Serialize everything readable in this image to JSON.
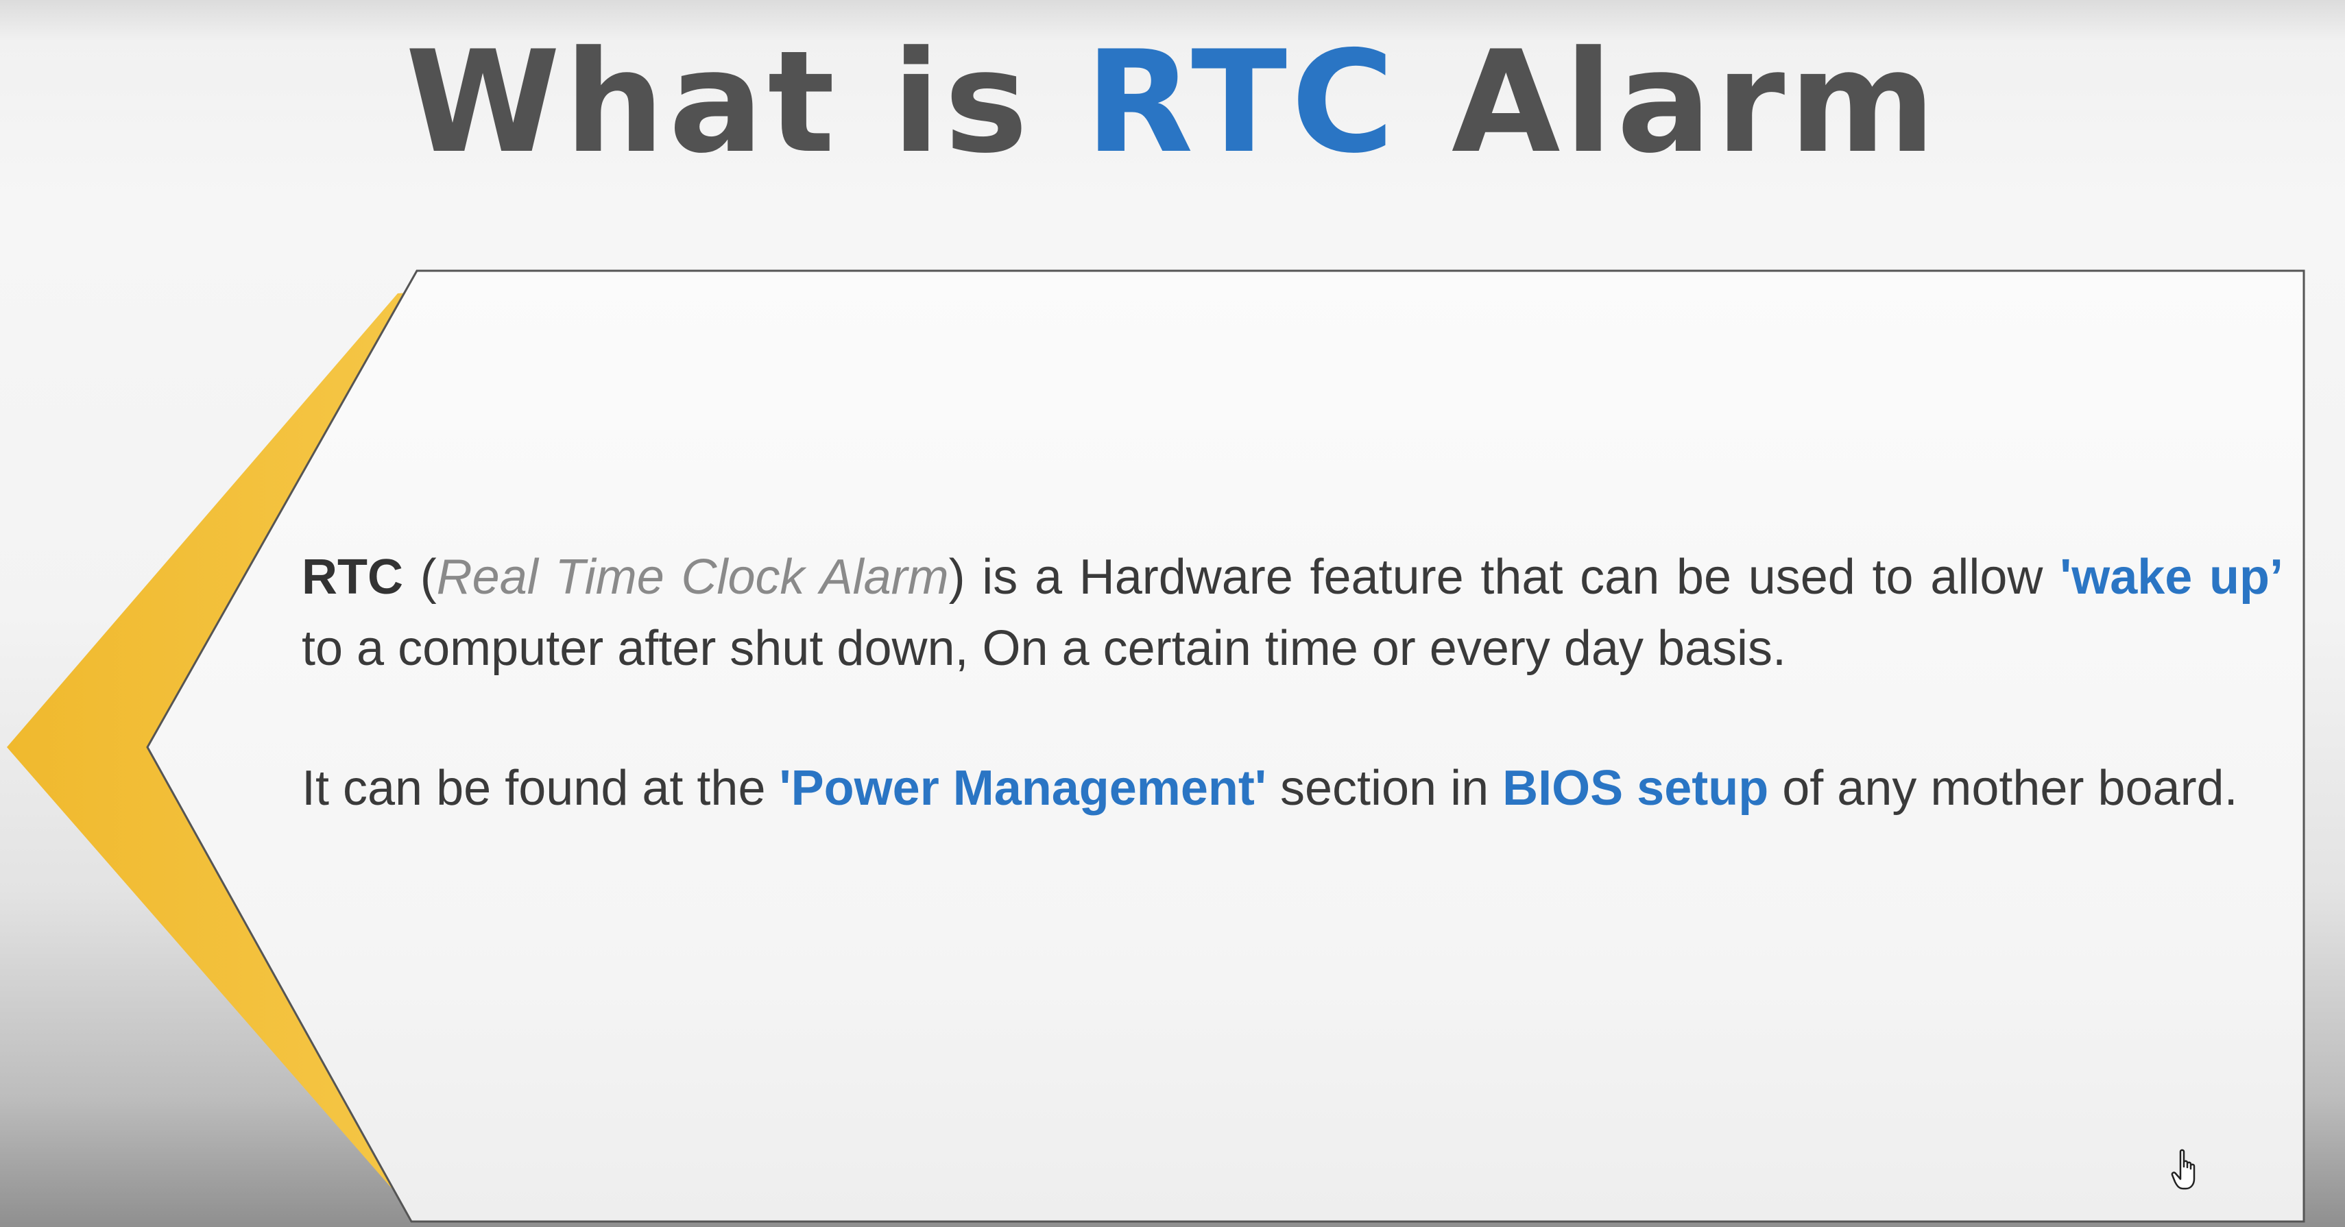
{
  "slide": {
    "title_part1": "What is",
    "title_accent": "RTC",
    "title_part2": "Alarm"
  },
  "content": {
    "p1": {
      "term": "RTC",
      "open_paren": "(",
      "expansion": "Real Time Clock Alarm",
      "after_expansion": ") is a Hardware feature that can be used to allow",
      "highlight": "'wake up’",
      "rest": "to a computer after shut down, On a certain time or every day basis."
    },
    "p2": {
      "lead": "It can be found at the",
      "highlight1": "'Power Management'",
      "middle": "section in",
      "highlight2": "BIOS setup",
      "rest": "of any mother board."
    }
  },
  "colors": {
    "accent_blue": "#2a75c4",
    "title_gray": "#525252",
    "chevron_yellow": "#f4c13e",
    "panel_white": "#fafafa"
  },
  "icons": {
    "cursor": "hand-pointer-icon"
  }
}
